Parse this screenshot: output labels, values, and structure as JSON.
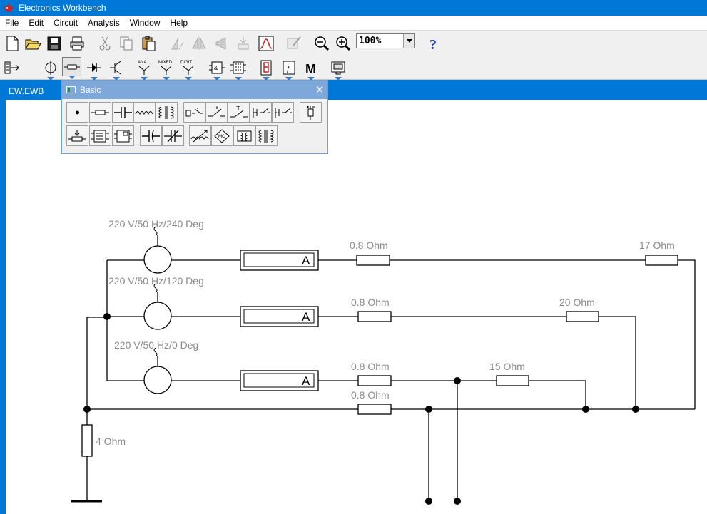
{
  "window": {
    "title": "Electronics Workbench"
  },
  "menu": {
    "items": [
      "File",
      "Edit",
      "Circuit",
      "Analysis",
      "Window",
      "Help"
    ]
  },
  "toolbar": {
    "zoom": "100%",
    "help_glyph": "?",
    "meters_glyph": "M"
  },
  "toolbar2_badges": {
    "analog": "ANA",
    "mixed": "MIXED",
    "digital": "DIGIT"
  },
  "document": {
    "title": "EW.EWB"
  },
  "palette": {
    "title": "Basic"
  },
  "circuit": {
    "sources": [
      {
        "label": "220 V/50 Hz/240 Deg"
      },
      {
        "label": "220 V/50 Hz/120 Deg"
      },
      {
        "label": "220 V/50 Hz/0 Deg"
      }
    ],
    "ammeter_symbol": "A",
    "resistors": [
      {
        "label": "0.8  Ohm"
      },
      {
        "label": "0.8  Ohm"
      },
      {
        "label": "0.8  Ohm"
      },
      {
        "label": "0.8  Ohm"
      },
      {
        "label": "17  Ohm"
      },
      {
        "label": "20  Ohm"
      },
      {
        "label": "15  Ohm"
      },
      {
        "label": "4  Ohm"
      }
    ]
  }
}
